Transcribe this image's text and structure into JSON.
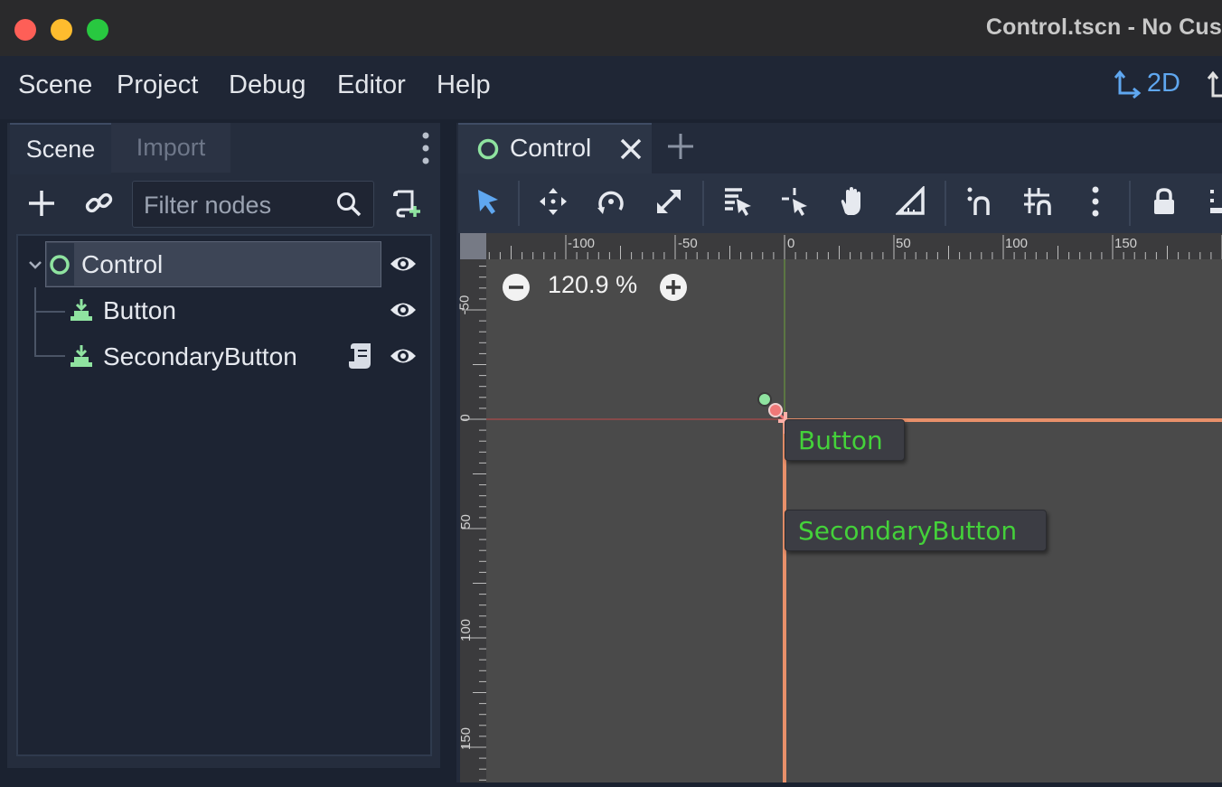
{
  "window": {
    "title": "Control.tscn - No Cus",
    "traffic_lights": {
      "close": "#fe5f57",
      "minimize": "#febc2e",
      "zoom": "#28c840"
    }
  },
  "menu": {
    "items": [
      "Scene",
      "Project",
      "Debug",
      "Editor",
      "Help"
    ],
    "mode_2d_label": "2D"
  },
  "scene_dock": {
    "tabs": {
      "scene": "Scene",
      "import": "Import"
    },
    "filter_placeholder": "Filter nodes",
    "tree": [
      {
        "label": "Control",
        "icon": "control-node-icon",
        "selected": true,
        "expanded": true
      },
      {
        "label": "Button",
        "icon": "button-node-icon"
      },
      {
        "label": "SecondaryButton",
        "icon": "button-node-icon",
        "has_script": true
      }
    ]
  },
  "viewport": {
    "tab_label": "Control",
    "zoom": "120.9 %",
    "ruler_h_labels": [
      "-100",
      "-50",
      "0",
      "50",
      "100",
      "150"
    ],
    "ruler_v_labels": [
      "-50",
      "0",
      "50",
      "100",
      "150"
    ],
    "canvas_buttons": {
      "button": "Button",
      "secondary": "SecondaryButton"
    }
  },
  "colors": {
    "accent_blue": "#5fa7f0",
    "node_green": "#8fe3a0",
    "button_text_green": "#44d13a",
    "control_rect": "#e8906a"
  }
}
